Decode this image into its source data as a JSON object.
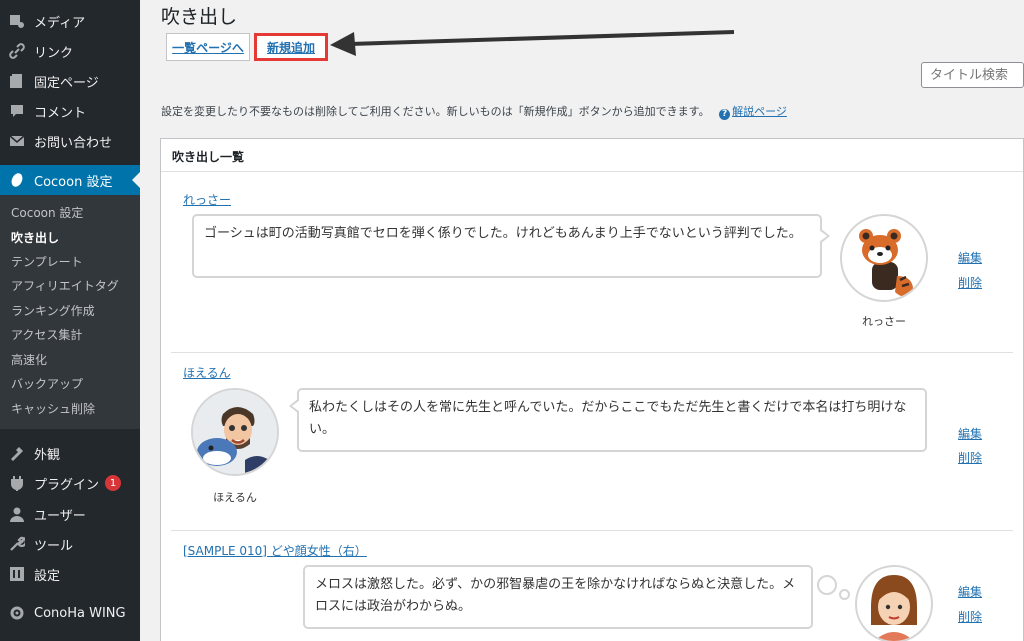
{
  "sidebar": {
    "items_top": [
      {
        "label": "メディア",
        "icon": "media-icon"
      },
      {
        "label": "リンク",
        "icon": "link-icon"
      },
      {
        "label": "固定ページ",
        "icon": "page-icon"
      },
      {
        "label": "コメント",
        "icon": "comment-icon"
      },
      {
        "label": "お問い合わせ",
        "icon": "mail-icon"
      }
    ],
    "active": {
      "label": "Cocoon 設定",
      "icon": "cocoon-icon"
    },
    "submenu": [
      "Cocoon 設定",
      "吹き出し",
      "テンプレート",
      "アフィリエイトタグ",
      "ランキング作成",
      "アクセス集計",
      "高速化",
      "バックアップ",
      "キャッシュ削除"
    ],
    "items_bottom": [
      {
        "label": "外観",
        "icon": "appearance-icon"
      },
      {
        "label": "プラグイン",
        "icon": "plugin-icon",
        "badge": "1"
      },
      {
        "label": "ユーザー",
        "icon": "user-icon"
      },
      {
        "label": "ツール",
        "icon": "tool-icon"
      },
      {
        "label": "設定",
        "icon": "settings-icon"
      },
      {
        "label": "ConoHa WING",
        "icon": "conoha-icon"
      }
    ]
  },
  "page": {
    "title": "吹き出し",
    "tab_list": "一覧ページへ",
    "tab_new": "新規追加",
    "search_placeholder": "タイトル検索",
    "description": "設定を変更したり不要なものは削除してご利用ください。新しいものは「新規作成」ボタンから追加できます。",
    "help_link": "解説ページ"
  },
  "panel": {
    "title": "吹き出し一覧",
    "edit_label": "編集",
    "delete_label": "削除",
    "entries": [
      {
        "name": "れっさー",
        "text": "ゴーシュは町の活動写真館でセロを弾く係りでした。けれどもあんまり上手でないという評判でした。",
        "avatar_label": "れっさー"
      },
      {
        "name": "ほえるん",
        "text": "私わたくしはその人を常に先生と呼んでいた。だからここでもただ先生と書くだけで本名は打ち明けない。",
        "avatar_label": "ほえるん"
      },
      {
        "name": "[SAMPLE 010] どや顔女性（右）",
        "text": "メロスは激怒した。必ず、かの邪智暴虐の王を除かなければならぬと決意した。メロスには政治がわからぬ。",
        "avatar_label": ""
      }
    ]
  },
  "colors": {
    "sidebar_bg": "#23282d",
    "active_bg": "#0073aa",
    "link": "#2271b1",
    "highlight": "#e53935"
  }
}
